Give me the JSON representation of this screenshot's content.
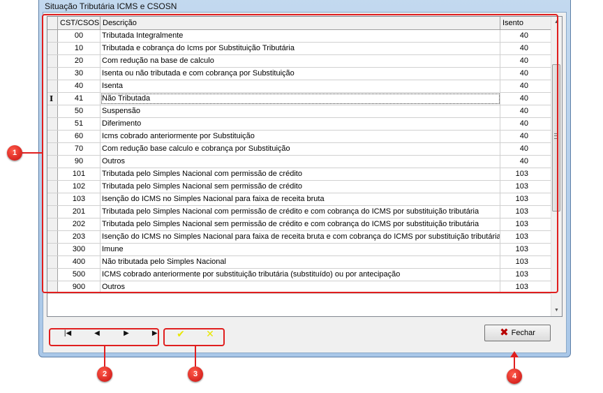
{
  "window": {
    "title": "Situação Tributária ICMS e CSOSN"
  },
  "grid": {
    "columns": {
      "cst": "CST/CSOSN",
      "descricao": "Descrição",
      "isento": "Isento"
    },
    "selected_row_marker": "I",
    "rows": [
      {
        "cst": "00",
        "desc": "Tributada Integralmente",
        "isento": "40"
      },
      {
        "cst": "10",
        "desc": "Tributada e cobrança do Icms por Substituição Tributária",
        "isento": "40"
      },
      {
        "cst": "20",
        "desc": "Com redução na base de calculo",
        "isento": "40"
      },
      {
        "cst": "30",
        "desc": "Isenta ou não tributada e com cobrança por Substituição",
        "isento": "40"
      },
      {
        "cst": "40",
        "desc": "Isenta",
        "isento": "40"
      },
      {
        "cst": "41",
        "desc": "Não Tributada",
        "isento": "40"
      },
      {
        "cst": "50",
        "desc": "Suspensão",
        "isento": "40"
      },
      {
        "cst": "51",
        "desc": "Diferimento",
        "isento": "40"
      },
      {
        "cst": "60",
        "desc": "Icms cobrado anteriormente por Substituição",
        "isento": "40"
      },
      {
        "cst": "70",
        "desc": "Com redução base calculo e cobrança por Substituição",
        "isento": "40"
      },
      {
        "cst": "90",
        "desc": "Outros",
        "isento": "40"
      },
      {
        "cst": "101",
        "desc": "Tributada pelo Simples Nacional com permissão de crédito",
        "isento": "103"
      },
      {
        "cst": "102",
        "desc": "Tributada pelo Simples Nacional sem permissão de crédito",
        "isento": "103"
      },
      {
        "cst": "103",
        "desc": "Isenção do ICMS no Simples Nacional para faixa de receita bruta",
        "isento": "103"
      },
      {
        "cst": "201",
        "desc": "Tributada pelo Simples Nacional com permissão de crédito e com cobrança do ICMS por substituição tributária",
        "isento": "103"
      },
      {
        "cst": "202",
        "desc": "Tributada pelo Simples Nacional sem permissão de crédito e com cobrança do ICMS por substituição tributária",
        "isento": "103"
      },
      {
        "cst": "203",
        "desc": "Isenção do ICMS no Simples Nacional para faixa de receita bruta e com cobrança do ICMS por substituição tributária",
        "isento": "103"
      },
      {
        "cst": "300",
        "desc": "Imune",
        "isento": "103"
      },
      {
        "cst": "400",
        "desc": "Não tributada pelo Simples Nacional",
        "isento": "103"
      },
      {
        "cst": "500",
        "desc": "ICMS cobrado anteriormente por substituição tributária (substituído) ou por antecipação",
        "isento": "103"
      },
      {
        "cst": "900",
        "desc": "Outros",
        "isento": "103"
      }
    ]
  },
  "navigator": {
    "first": "|◀",
    "prior": "◀",
    "next": "▶",
    "last": "▶|",
    "post": "✔",
    "cancel": "✕"
  },
  "buttons": {
    "fechar": "Fechar"
  },
  "annotations": {
    "one": "1",
    "two": "2",
    "three": "3",
    "four": "4"
  },
  "colors": {
    "annotation": "#e01e1e",
    "post_cancel": "#e8e800",
    "close_x": "#b80000"
  }
}
